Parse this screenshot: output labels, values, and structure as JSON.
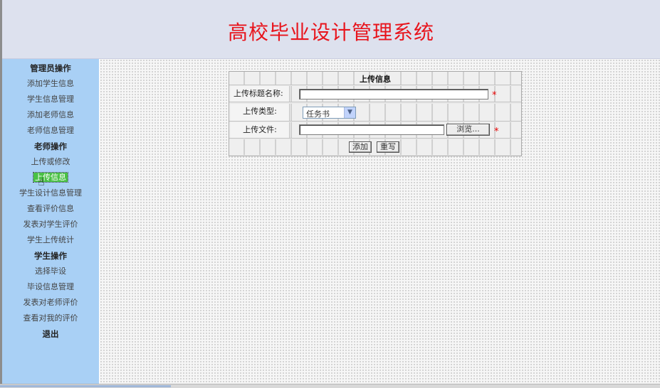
{
  "header": {
    "title": "高校毕业设计管理系统"
  },
  "sidebar": {
    "admin": {
      "title": "管理员操作",
      "items": [
        "添加学生信息",
        "学生信息管理",
        "添加老师信息",
        "老师信息管理"
      ]
    },
    "teacher": {
      "title": "老师操作",
      "items": [
        "上传或修改",
        "上传信息",
        "学生设计信息管理",
        "查看评价信息",
        "发表对学生评价",
        "学生上传统计"
      ]
    },
    "student": {
      "title": "学生操作",
      "items": [
        "选择毕设",
        "毕设信息管理",
        "发表对老师评价",
        "查看对我的评价"
      ]
    },
    "logout": "退出"
  },
  "form": {
    "title": "上传信息",
    "title_label": "上传标题名称:",
    "title_value": "",
    "type_label": "上传类型:",
    "type_value": "任务书",
    "file_label": "上传文件:",
    "file_value": "",
    "browse_label": "浏览...",
    "required_mark": "*",
    "add_label": "添加",
    "reset_label": "重写"
  },
  "colors": {
    "title": "#e8141c",
    "header_bg": "#dde1ee",
    "sidebar_bg": "#a9d0f5",
    "active_item": "#49c145",
    "required": "#e80000"
  }
}
